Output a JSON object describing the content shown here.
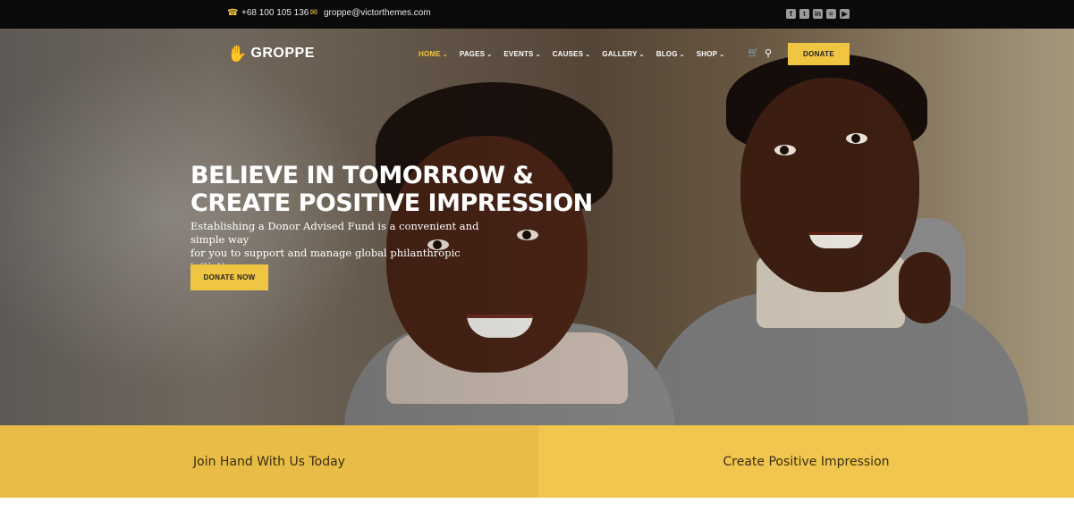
{
  "topbar": {
    "phone": "+68 100 105 136",
    "email": "groppe@victorthemes.com",
    "socials": [
      "facebook-icon",
      "twitter-icon",
      "linkedin-icon",
      "rss-icon",
      "youtube-icon"
    ]
  },
  "brand": {
    "name": "GROPPE",
    "accent": "#f0c542"
  },
  "nav": {
    "items": [
      {
        "label": "HOME",
        "active": true
      },
      {
        "label": "PAGES"
      },
      {
        "label": "EVENTS"
      },
      {
        "label": "CAUSES"
      },
      {
        "label": "GALLERY"
      },
      {
        "label": "BLOG"
      },
      {
        "label": "SHOP"
      }
    ],
    "donate_label": "DONATE"
  },
  "hero": {
    "headline_line1": "BELIEVE IN TOMORROW &",
    "headline_line2": "CREATE POSITIVE IMPRESSION",
    "sub_line1": "Establishing a Donor Advised Fund is a convenient and simple way",
    "sub_line2": "for you to support and manage global philanthropic initiatives.",
    "cta_label": "DONATE NOW"
  },
  "bands": {
    "left": "Join Hand With Us Today",
    "right": "Create Positive Impression"
  }
}
